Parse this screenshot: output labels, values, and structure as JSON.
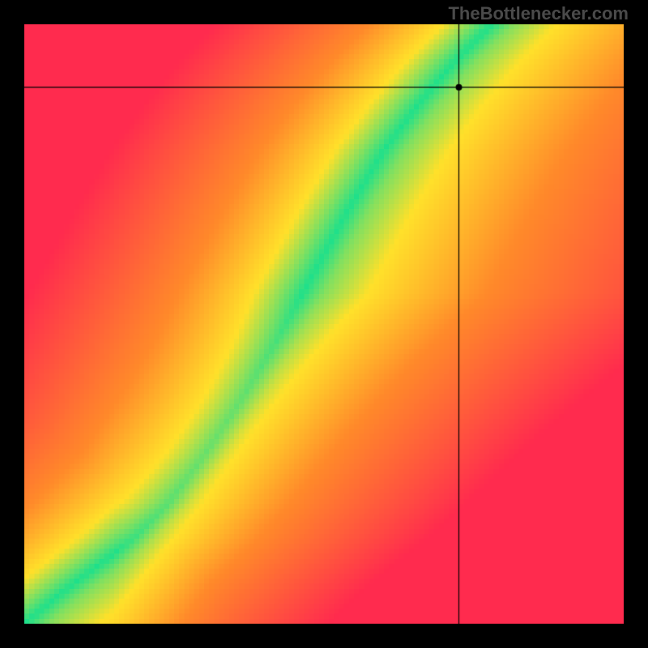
{
  "watermark": "TheBottlenecker.com",
  "colors": {
    "red": "#ff2b4e",
    "orange": "#ff8a2a",
    "yellow": "#ffe12a",
    "green": "#1fe08b"
  },
  "chart_data": {
    "type": "heatmap",
    "title": "",
    "xlabel": "",
    "ylabel": "",
    "xlim": [
      0,
      1
    ],
    "ylim": [
      0,
      1
    ],
    "resolution": 120,
    "crosshair": {
      "x": 0.725,
      "y": 0.895
    },
    "marker_radius_px": 4,
    "ridge": {
      "description": "Optimal (green) band centerline, normalized coords origin at bottom-left",
      "points": [
        [
          0.0,
          0.0
        ],
        [
          0.06,
          0.05
        ],
        [
          0.12,
          0.095
        ],
        [
          0.18,
          0.14
        ],
        [
          0.24,
          0.2
        ],
        [
          0.3,
          0.28
        ],
        [
          0.36,
          0.37
        ],
        [
          0.42,
          0.47
        ],
        [
          0.48,
          0.58
        ],
        [
          0.54,
          0.69
        ],
        [
          0.6,
          0.79
        ],
        [
          0.66,
          0.87
        ],
        [
          0.72,
          0.94
        ],
        [
          0.78,
          1.0
        ]
      ],
      "green_halfwidth": 0.035,
      "yellow_halfwidth": 0.09
    },
    "background_field": {
      "description": "Signed distance to ridge normalized by local scale; mapped red→orange→yellow→green→yellow→orange→red. Additionally, the left side (x<<ridge) trends red faster than the right side.",
      "left_bias": 1.35,
      "right_bias": 0.85
    }
  }
}
